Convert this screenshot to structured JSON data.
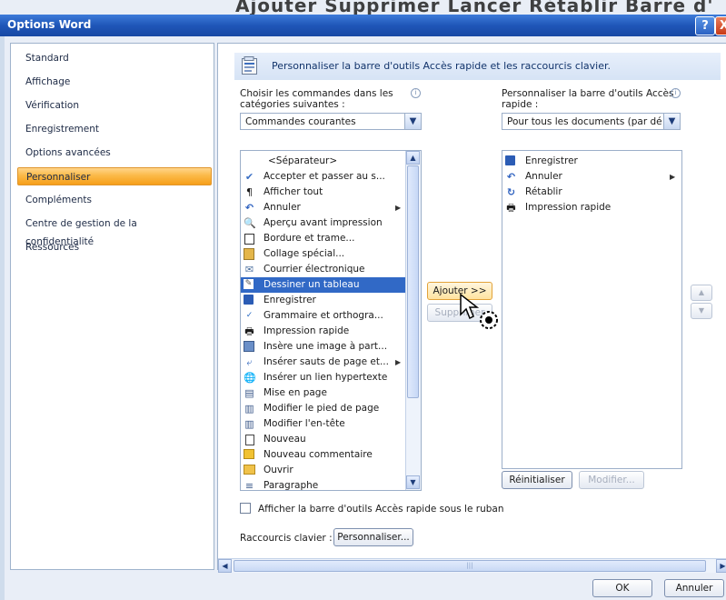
{
  "top_residual_text": "_  Ajouter  Supprimer  Lancer  Rétablir  Barre d'",
  "window": {
    "title": "Options Word",
    "help_label": "?",
    "close_label": "X"
  },
  "nav": {
    "items": [
      {
        "label": "Standard",
        "selected": false
      },
      {
        "label": "Affichage",
        "selected": false
      },
      {
        "label": "Vérification",
        "selected": false
      },
      {
        "label": "Enregistrement",
        "selected": false
      },
      {
        "label": "Options avancées",
        "selected": false
      },
      {
        "label": "Personnaliser",
        "selected": true
      },
      {
        "label": "Compléments",
        "selected": false
      },
      {
        "label": "Centre de gestion de la confidentialité",
        "selected": false
      },
      {
        "label": "Ressources",
        "selected": false
      }
    ]
  },
  "header": {
    "title": "Personnaliser la barre d'outils Accès rapide et les raccourcis clavier."
  },
  "left_panel": {
    "label_line1": "Choisir les commandes dans les",
    "label_line2": "catégories suivantes :",
    "combo_value": "Commandes courantes",
    "items": [
      {
        "label": "<Séparateur>",
        "icon": "separator",
        "submenu": false,
        "selected": false
      },
      {
        "label": "Accepter et passer au s...",
        "icon": "accept-change-icon",
        "submenu": false,
        "selected": false
      },
      {
        "label": "Afficher tout",
        "icon": "pilcrow-icon",
        "submenu": false,
        "selected": false
      },
      {
        "label": "Annuler",
        "icon": "undo-icon",
        "submenu": true,
        "selected": false
      },
      {
        "label": "Aperçu avant impression",
        "icon": "print-preview-icon",
        "submenu": false,
        "selected": false
      },
      {
        "label": "Bordure et trame...",
        "icon": "border-icon",
        "submenu": false,
        "selected": false
      },
      {
        "label": "Collage spécial...",
        "icon": "paste-special-icon",
        "submenu": false,
        "selected": false
      },
      {
        "label": "Courrier électronique",
        "icon": "email-icon",
        "submenu": false,
        "selected": false
      },
      {
        "label": "Dessiner un tableau",
        "icon": "draw-table-icon",
        "submenu": false,
        "selected": true
      },
      {
        "label": "Enregistrer",
        "icon": "save-icon",
        "submenu": false,
        "selected": false
      },
      {
        "label": "Grammaire et orthogra...",
        "icon": "spelling-icon",
        "submenu": false,
        "selected": false
      },
      {
        "label": "Impression rapide",
        "icon": "quick-print-icon",
        "submenu": false,
        "selected": false
      },
      {
        "label": "Insère une image à part...",
        "icon": "insert-picture-icon",
        "submenu": false,
        "selected": false
      },
      {
        "label": "Insérer sauts de page et...",
        "icon": "page-break-icon",
        "submenu": true,
        "selected": false
      },
      {
        "label": "Insérer un lien hypertexte",
        "icon": "hyperlink-icon",
        "submenu": false,
        "selected": false
      },
      {
        "label": "Mise en page",
        "icon": "page-setup-icon",
        "submenu": false,
        "selected": false
      },
      {
        "label": "Modifier le pied de page",
        "icon": "footer-icon",
        "submenu": false,
        "selected": false
      },
      {
        "label": "Modifier l'en-tête",
        "icon": "header-icon",
        "submenu": false,
        "selected": false
      },
      {
        "label": "Nouveau",
        "icon": "new-document-icon",
        "submenu": false,
        "selected": false
      },
      {
        "label": "Nouveau commentaire",
        "icon": "new-comment-icon",
        "submenu": false,
        "selected": false
      },
      {
        "label": "Ouvrir",
        "icon": "open-folder-icon",
        "submenu": false,
        "selected": false
      },
      {
        "label": "Paragraphe",
        "icon": "paragraph-icon",
        "submenu": false,
        "selected": false
      }
    ]
  },
  "right_panel": {
    "label_line1": "Personnaliser la barre d'outils Accès",
    "label_line2": "rapide :",
    "combo_value": "Pour tous les documents (par dé...",
    "items": [
      {
        "label": "Enregistrer",
        "icon": "save-icon",
        "submenu": false
      },
      {
        "label": "Annuler",
        "icon": "undo-icon",
        "submenu": true
      },
      {
        "label": "Rétablir",
        "icon": "redo-icon",
        "submenu": false
      },
      {
        "label": "Impression rapide",
        "icon": "quick-print-icon",
        "submenu": false
      }
    ],
    "reset_label": "Réinitialiser",
    "modify_label": "Modifier..."
  },
  "buttons": {
    "add_label": "Ajouter >>",
    "remove_label": "Supprimer",
    "ok_label": "OK",
    "cancel_label": "Annuler",
    "keyboard_customize_label": "Personnaliser..."
  },
  "checkbox": {
    "label": "Afficher la barre d'outils Accès rapide sous le ruban",
    "checked": false
  },
  "keyboard": {
    "label": "Raccourcis clavier :"
  },
  "colors": {
    "title_bar": "#1f56b8",
    "selection": "#3169c6",
    "nav_selected": "#fbb948"
  }
}
